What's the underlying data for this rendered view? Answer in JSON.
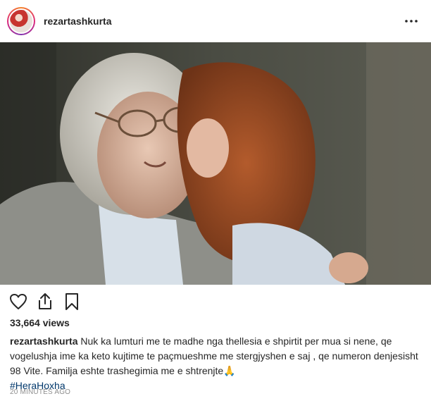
{
  "header": {
    "username": "rezartashkurta",
    "more_icon": "ellipsis-horizontal-icon"
  },
  "media": {
    "type": "video-still",
    "icon": "none"
  },
  "actions": {
    "like_icon": "heart-outline-icon",
    "share_icon": "share-upload-icon",
    "save_icon": "bookmark-outline-icon"
  },
  "stats": {
    "views": "33,664 views"
  },
  "caption": {
    "username": "rezartashkurta",
    "text": "Nuk ka lumturi me te madhe nga thellesia e shpirtit per mua si nene, qe vogelushja ime ka keto kujtime te paçmueshme me stergjyshen e saj , qe numeron denjesisht 98 Vite. Familja eshte trashegimia me e shtrenjte🙏",
    "hashtag": "#HeraHoxha"
  },
  "timestamp": "20 MINUTES AGO"
}
